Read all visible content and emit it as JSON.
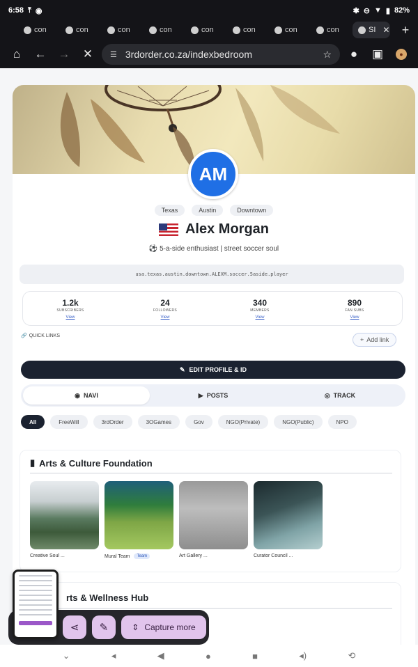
{
  "status": {
    "time": "6:58",
    "battery": "82%"
  },
  "tabs": [
    {
      "label": "con"
    },
    {
      "label": "con"
    },
    {
      "label": "con"
    },
    {
      "label": "con"
    },
    {
      "label": "con"
    },
    {
      "label": "con"
    },
    {
      "label": "con"
    },
    {
      "label": "con"
    },
    {
      "label": "SI"
    }
  ],
  "toolbar": {
    "url": "3rdorder.co.za/indexbedroom"
  },
  "profile": {
    "initials": "AM",
    "locations": [
      "Texas",
      "Austin",
      "Downtown"
    ],
    "name": "Alex Morgan",
    "bio": "⚽ 5-a-side enthusiast | street soccer soul",
    "id": "usa.texas.austin.downtown.ALEXM.soccer.5aside.player",
    "stats": [
      {
        "value": "1.2k",
        "label": "SUBSCRIBERS",
        "link": "View"
      },
      {
        "value": "24",
        "label": "FOLLOWERS",
        "link": "View"
      },
      {
        "value": "340",
        "label": "MEMBERS",
        "link": "View"
      },
      {
        "value": "890",
        "label": "FAN SUBS",
        "link": "View"
      }
    ],
    "quick_links": "QUICK LINKS",
    "add_link": "Add link",
    "edit_button": "EDIT PROFILE & ID"
  },
  "segments": [
    "NAVI",
    "POSTS",
    "TRACK"
  ],
  "filters": [
    "All",
    "FreeWill",
    "3rdOrder",
    "3OGames",
    "Gov",
    "NGO(Private)",
    "NGO(Public)",
    "NPO"
  ],
  "section1": {
    "title": "Arts & Culture Foundation",
    "items": [
      {
        "caption": "Creative Soul ...",
        "badge": ""
      },
      {
        "caption": "Mural Team",
        "badge": "Team"
      },
      {
        "caption": "Art Gallery ...",
        "badge": ""
      },
      {
        "caption": "Curator Council ...",
        "badge": ""
      }
    ]
  },
  "section2": {
    "title": "rts & Wellness Hub"
  },
  "capture": {
    "more": "Capture more"
  },
  "colors": {
    "accent": "#1f6fe5",
    "dark": "#1b2230",
    "capture_button": "#e1c4ec"
  }
}
